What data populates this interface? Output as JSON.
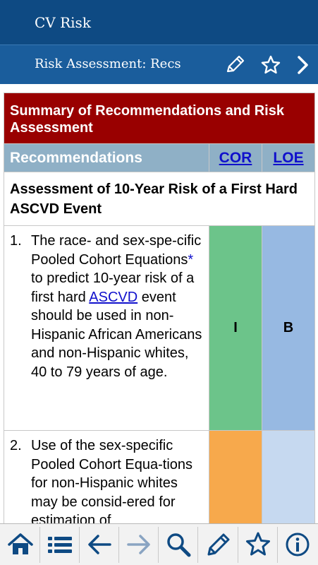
{
  "app": {
    "title": "CV Risk"
  },
  "subheader": {
    "title": "Risk Assessment: Recs",
    "icons": [
      "pencil-icon",
      "star-icon",
      "chevron-right-icon"
    ]
  },
  "table": {
    "header": "Summary of Recommendations and Risk Assessment",
    "columns": {
      "recommendations": "Recommendations",
      "cor": "COR",
      "loe": "LOE"
    },
    "section_title": "Assessment of 10-Year Risk of a First Hard ASCVD Event",
    "rows": [
      {
        "number": "1.",
        "text_before": "The race- and sex-spe-cific Pooled Cohort Equations",
        "asterisk": "*",
        "text_middle": " to predict 10-year risk of a first hard ",
        "link": "ASCVD",
        "text_after": " event should be used in non-Hispanic African Americans and non-Hispanic whites, 40 to 79 years of age.",
        "cor": "I",
        "loe": "B",
        "cor_color": "#6cc48a",
        "loe_color": "#97b9e2"
      },
      {
        "number": "2.",
        "text_before": "Use of the sex-specific Pooled Cohort Equa-tions for non-Hispanic whites may be consid-ered for estimation of",
        "cor": "",
        "loe": "",
        "cor_color": "#f7a94c",
        "loe_color": "#c6d9f0"
      }
    ]
  },
  "bottom_nav": [
    "home-icon",
    "list-icon",
    "arrow-left-icon",
    "arrow-right-icon",
    "search-icon",
    "pencil-icon",
    "star-icon",
    "info-icon"
  ],
  "colors": {
    "top_bar": "#0e4a83",
    "sub_bar": "#1a5d9c",
    "header_red": "#990000",
    "column_header": "#8fb0c6",
    "link": "#1010cc"
  }
}
